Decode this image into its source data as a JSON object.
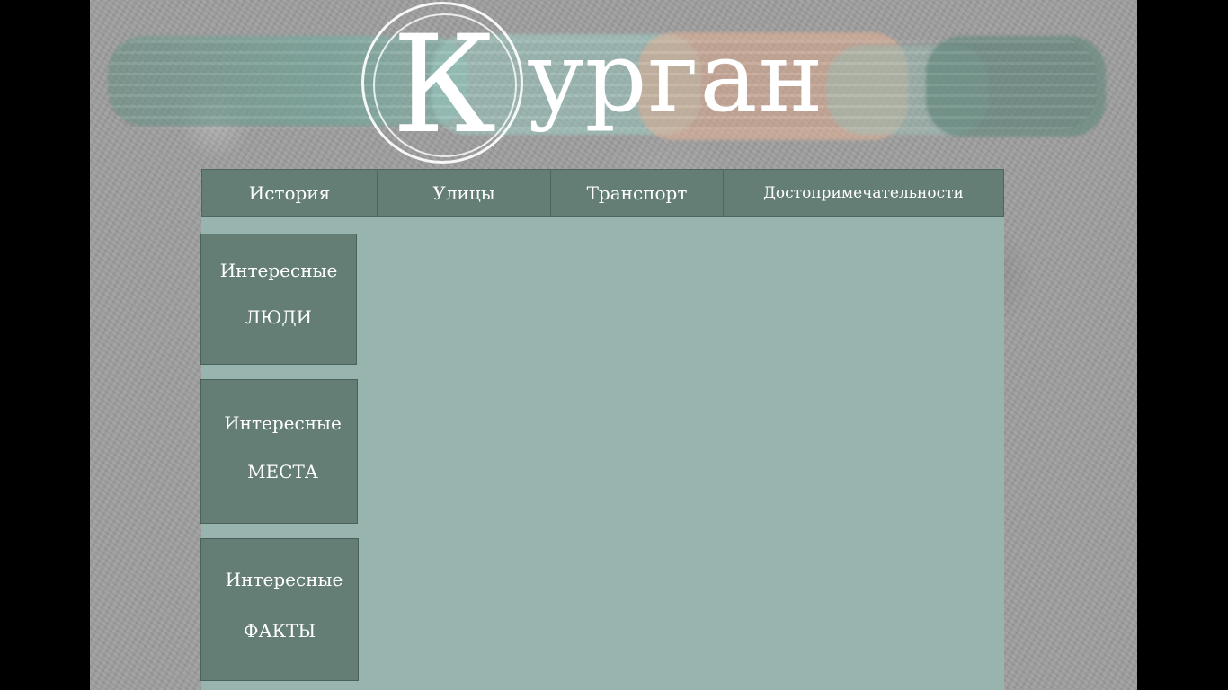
{
  "header": {
    "logo_initial": "К",
    "logo_rest": "урган"
  },
  "nav": {
    "items": [
      {
        "label": "История"
      },
      {
        "label": "Улицы"
      },
      {
        "label": "Транспорт"
      },
      {
        "label": "Достопримечательности"
      }
    ]
  },
  "sidebar": {
    "items": [
      {
        "line1": "Интересные",
        "line2": "ЛЮДИ"
      },
      {
        "line1": "Интересные",
        "line2": "МЕСТА"
      },
      {
        "line1": "Интересные",
        "line2": "ФАКТЫ"
      }
    ]
  },
  "colors": {
    "nav_bg": "#647e76",
    "content_bg": "#98b4ae",
    "text": "#ffffff"
  }
}
